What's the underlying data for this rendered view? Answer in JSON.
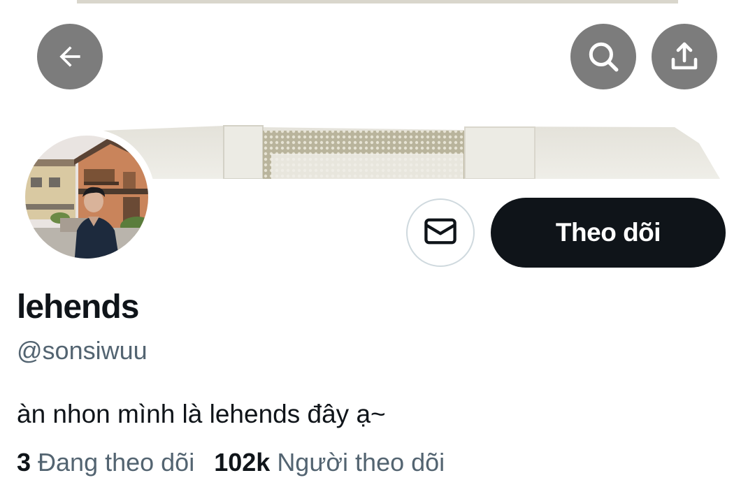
{
  "header": {
    "back_icon": "arrow-left-icon",
    "search_icon": "search-icon",
    "share_icon": "share-upload-icon"
  },
  "profile": {
    "display_name": "lehends",
    "handle": "@sonsiwuu",
    "bio": "àn nhon mình là lehends đây ạ~",
    "following_count": "3",
    "following_label": "Đang theo dõi",
    "followers_count": "102k",
    "followers_label": "Người theo dõi"
  },
  "actions": {
    "message_icon": "envelope-icon",
    "follow_label": "Theo dõi"
  },
  "colors": {
    "follow_button_bg": "#0f1419",
    "secondary_text": "#536471",
    "icon_button_bg": "#5f5f5f"
  }
}
